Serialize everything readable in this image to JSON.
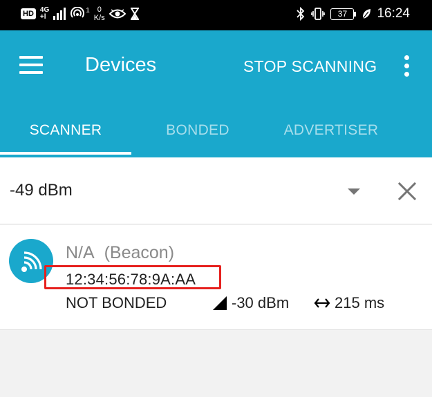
{
  "status_bar": {
    "hd_label": "HD",
    "network_type_top": "4G",
    "network_type_bottom": "+l",
    "hotspot_count": "1",
    "speed_value": "0",
    "speed_unit": "K/s",
    "battery_level": "37",
    "time": "16:24",
    "icons": [
      "hd-icon",
      "signal-icon",
      "hotspot-icon",
      "eye-icon",
      "hourglass-icon",
      "bluetooth-icon",
      "vibrate-icon",
      "battery-icon",
      "leaf-icon"
    ]
  },
  "app_bar": {
    "title": "Devices",
    "stop_scanning_label": "STOP SCANNING",
    "background_color": "#1aa8cc"
  },
  "tabs": [
    {
      "label": "SCANNER",
      "active": true
    },
    {
      "label": "BONDED",
      "active": false
    },
    {
      "label": "ADVERTISER",
      "active": false
    }
  ],
  "filter": {
    "rssi_value": "-49 dBm"
  },
  "devices": [
    {
      "name": "N/A",
      "type": "(Beacon)",
      "address": "12:34:56:78:9A:AA",
      "bond_state": "NOT BONDED",
      "rssi": "-30 dBm",
      "interval": "215 ms",
      "highlight_color": "#e6211e"
    }
  ]
}
